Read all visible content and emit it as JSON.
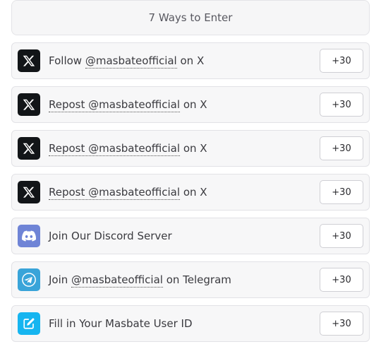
{
  "header": {
    "title": "7 Ways to Enter"
  },
  "entries": [
    {
      "icon": "x-logo-icon",
      "prefix": "Follow ",
      "handle": "@masbateofficial",
      "suffix": " on X",
      "points": "+30"
    },
    {
      "icon": "x-logo-icon",
      "prefix": "",
      "handle": "Repost @masbateofficial",
      "suffix": " on X",
      "points": "+30"
    },
    {
      "icon": "x-logo-icon",
      "prefix": "",
      "handle": "Repost @masbateofficial",
      "suffix": " on X",
      "points": "+30"
    },
    {
      "icon": "x-logo-icon",
      "prefix": "",
      "handle": "Repost @masbateofficial",
      "suffix": " on X",
      "points": "+30"
    },
    {
      "icon": "discord-icon",
      "prefix": "Join Our Discord Server",
      "handle": "",
      "suffix": "",
      "points": "+30"
    },
    {
      "icon": "telegram-icon",
      "prefix": "Join ",
      "handle": "@masbateofficial",
      "suffix": " on Telegram",
      "points": "+30"
    },
    {
      "icon": "edit-form-icon",
      "prefix": "Fill in Your Masbate User ID",
      "handle": "",
      "suffix": "",
      "points": "+30"
    }
  ],
  "colors": {
    "x_icon_bg": "#121518",
    "discord_icon_bg": "#6f84d6",
    "telegram_icon_bg": "#39a4d9",
    "form_icon_bg": "#16b5f0"
  }
}
